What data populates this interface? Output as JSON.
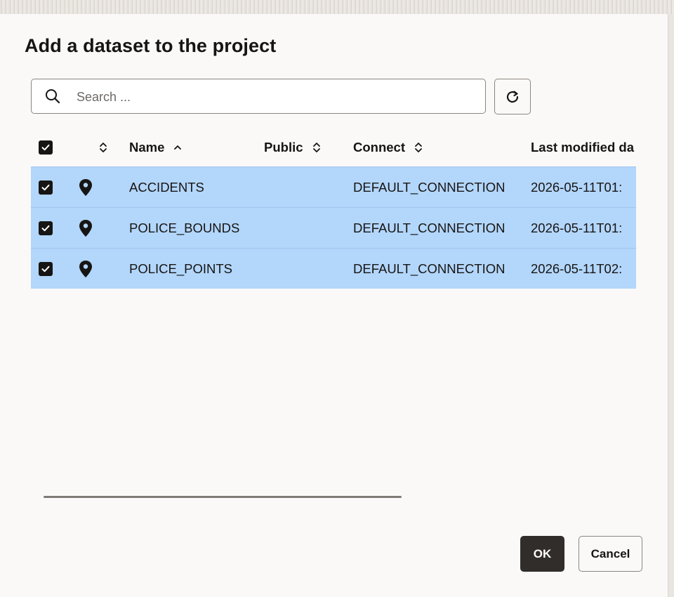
{
  "dialog": {
    "title": "Add a dataset to the project"
  },
  "search": {
    "placeholder": "Search ...",
    "value": ""
  },
  "table": {
    "columns": {
      "name": "Name",
      "public": "Public",
      "connect": "Connect",
      "last_modified": "Last modified da"
    },
    "rows": [
      {
        "name": "ACCIDENTS",
        "public": "",
        "connect": "DEFAULT_CONNECTION",
        "last_modified": "2026-05-11T01:",
        "checked": true,
        "icon": "map-pin-icon"
      },
      {
        "name": "POLICE_BOUNDS",
        "public": "",
        "connect": "DEFAULT_CONNECTION",
        "last_modified": "2026-05-11T01:",
        "checked": true,
        "icon": "map-pin-icon"
      },
      {
        "name": "POLICE_POINTS",
        "public": "",
        "connect": "DEFAULT_CONNECTION",
        "last_modified": "2026-05-11T02:",
        "checked": true,
        "icon": "map-pin-icon"
      }
    ]
  },
  "footer": {
    "ok_label": "OK",
    "cancel_label": "Cancel"
  },
  "colors": {
    "selected_row": "#b3d6fb",
    "primary_button": "#312d2a",
    "background": "#fbf9f8"
  }
}
